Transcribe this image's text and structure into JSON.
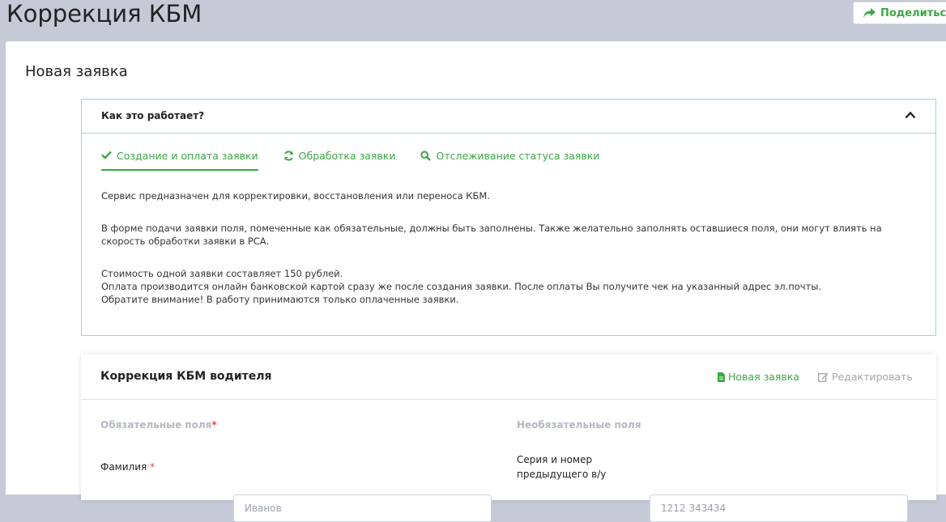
{
  "page": {
    "title": "Коррекция КБМ",
    "share_label": "Поделиться"
  },
  "panel": {
    "title": "Новая заявка"
  },
  "accordion": {
    "title": "Как это работает?",
    "tabs": [
      {
        "label": "Создание и оплата заявки",
        "icon": "check-icon",
        "active": true
      },
      {
        "label": "Обработка заявки",
        "icon": "refresh-icon",
        "active": false
      },
      {
        "label": "Отслеживание статуса заявки",
        "icon": "search-icon",
        "active": false
      }
    ],
    "paragraphs": {
      "p1": "Сервис предназначен для корректировки, восстановления или переноса КБМ.",
      "p2": "В форме подачи заявки поля, помеченные как обязательные, должны быть заполнены. Также желательно заполнять оставшиеся поля, они могут влиять на скорость обработки заявки в РСА.",
      "p3_line1": "Стоимость одной заявки составляет 150 рублей.",
      "p3_line2": "Оплата производится онлайн банковской картой сразу же после создания заявки. После оплаты Вы получите чек на указанный адрес эл.почты.",
      "p3_line3": "Обратите внимание! В работу принимаются только оплаченные заявки."
    }
  },
  "form": {
    "title": "Коррекция КБМ водителя",
    "new_label": "Новая заявка",
    "edit_label": "Редактировать",
    "required_section": "Обязательные поля",
    "required_mark": "*",
    "optional_section": "Необязательные поля",
    "surname_label": "Фамилия",
    "surname_placeholder": "Иванов",
    "prev_license_label_line1": "Серия и номер",
    "prev_license_label_line2": "предыдущего в/у",
    "prev_license_placeholder": "1212 343434"
  },
  "colors": {
    "accent": "#3aa845",
    "required": "#e04848",
    "border": "#a9cde0",
    "background": "#c5cad6"
  }
}
